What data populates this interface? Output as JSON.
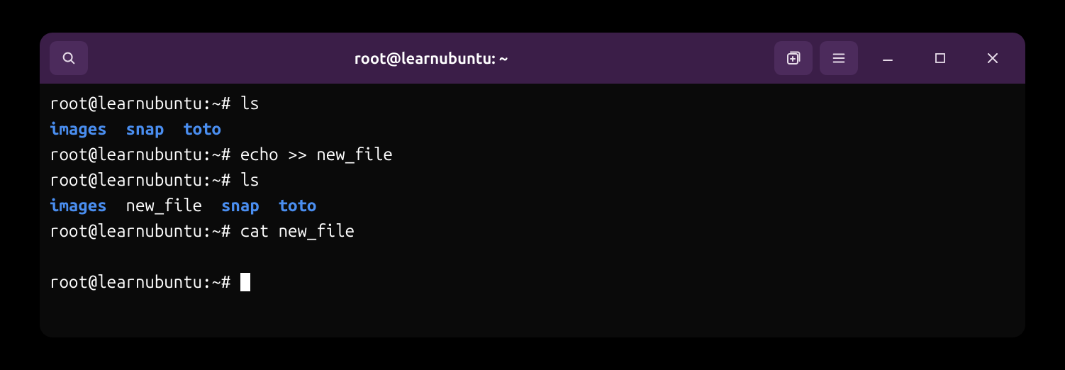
{
  "title": "root@learnubuntu: ~",
  "prompt": "root@learnubuntu:~# ",
  "lines": [
    {
      "type": "prompt",
      "cmd": "ls"
    },
    {
      "type": "ls",
      "items": [
        {
          "name": "images",
          "dir": true
        },
        {
          "name": "snap",
          "dir": true
        },
        {
          "name": "toto",
          "dir": true
        }
      ]
    },
    {
      "type": "prompt",
      "cmd": "echo >> new_file"
    },
    {
      "type": "prompt",
      "cmd": "ls"
    },
    {
      "type": "ls",
      "items": [
        {
          "name": "images",
          "dir": true
        },
        {
          "name": "new_file",
          "dir": false
        },
        {
          "name": "snap",
          "dir": true
        },
        {
          "name": "toto",
          "dir": true
        }
      ]
    },
    {
      "type": "prompt",
      "cmd": "cat new_file"
    },
    {
      "type": "blank"
    },
    {
      "type": "prompt",
      "cmd": "",
      "cursor": true
    }
  ]
}
